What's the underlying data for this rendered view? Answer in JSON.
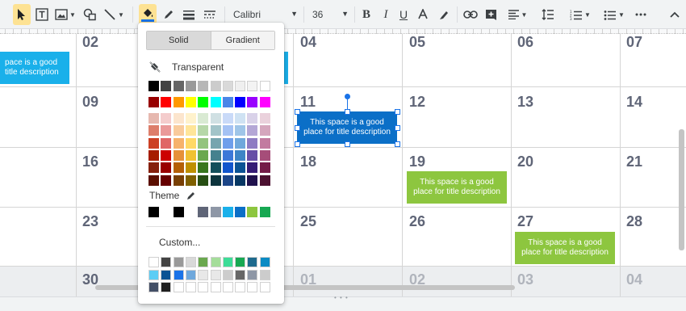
{
  "toolbar": {
    "font_name": "Calibri",
    "font_size": "36",
    "tools": [
      "select-tool",
      "text-tool",
      "image-tool",
      "shape-tool",
      "line-tool",
      "fill-color",
      "border-color",
      "border-weight",
      "border-dash"
    ],
    "fill_color_underline": "#1a73e8"
  },
  "calendar": {
    "rows": [
      [
        "02",
        "",
        "04",
        "05",
        "06",
        "07"
      ],
      [
        "09",
        "",
        "11",
        "12",
        "13",
        "14"
      ],
      [
        "16",
        "",
        "18",
        "19",
        "20",
        "21"
      ],
      [
        "23",
        "",
        "25",
        "26",
        "27",
        "28"
      ],
      [
        "30",
        "",
        "01",
        "02",
        "03",
        "04"
      ]
    ],
    "events": {
      "row1_blue_left": "pace is a good title description",
      "selected_11": "This space is a good place for title description",
      "green_19": "This space is a good place for title description",
      "green_27": "This space is a good place for title description"
    },
    "colors": {
      "blue": "#1ab0ea",
      "selected_blue": "#0b6fc7",
      "green": "#8dc63f",
      "day_text": "#5f6577"
    }
  },
  "color_picker": {
    "tab_solid": "Solid",
    "tab_gradient": "Gradient",
    "transparent_label": "Transparent",
    "theme_label": "Theme",
    "custom_label": "Custom...",
    "grays": [
      "#000000",
      "#434343",
      "#666666",
      "#999999",
      "#b7b7b7",
      "#cccccc",
      "#d9d9d9",
      "#efefef",
      "#f3f3f3",
      "#ffffff"
    ],
    "brights": [
      "#980000",
      "#ff0000",
      "#ff9900",
      "#ffff00",
      "#00ff00",
      "#00ffff",
      "#4a86e8",
      "#0000ff",
      "#9900ff",
      "#ff00ff"
    ],
    "shades": [
      [
        "#e6b8af",
        "#f4cccc",
        "#fce5cd",
        "#fff2cc",
        "#d9ead3",
        "#d0e0e3",
        "#c9daf8",
        "#cfe2f3",
        "#d9d2e9",
        "#ead1dc"
      ],
      [
        "#dd7e6b",
        "#ea9999",
        "#f9cb9c",
        "#ffe599",
        "#b6d7a8",
        "#a2c4c9",
        "#a4c2f4",
        "#9fc5e8",
        "#b4a7d6",
        "#d5a6bd"
      ],
      [
        "#cc4125",
        "#e06666",
        "#f6b26b",
        "#ffd966",
        "#93c47d",
        "#76a5af",
        "#6d9eeb",
        "#6fa8dc",
        "#8e7cc3",
        "#c27ba0"
      ],
      [
        "#a61c00",
        "#cc0000",
        "#e69138",
        "#f1c232",
        "#6aa84f",
        "#45818e",
        "#3c78d8",
        "#3d85c6",
        "#674ea7",
        "#a64d79"
      ],
      [
        "#85200c",
        "#990000",
        "#b45f06",
        "#bf9000",
        "#38761d",
        "#134f5c",
        "#1155cc",
        "#0b5394",
        "#351c75",
        "#741b47"
      ],
      [
        "#5b0f00",
        "#660000",
        "#783f04",
        "#7f6000",
        "#274e13",
        "#0c343d",
        "#1c4587",
        "#073763",
        "#20124d",
        "#4c1130"
      ]
    ],
    "theme": [
      "#000000",
      "#ffffff",
      "#000000",
      "#ffffff",
      "#5f6577",
      "#8e97a6",
      "#1ab0ea",
      "#0b6fc7",
      "#8dc63f",
      "#17a852"
    ],
    "custom": [
      [
        "#ffffff",
        "#434343",
        "#999999",
        "#d9d9d9",
        "#6aa84f",
        "#a4dd9a",
        "#3ddc97",
        "#17a852",
        "#1e6a8d",
        "#0b8bc4"
      ],
      [
        "#5bcdf5",
        "#0b5394",
        "#1a73e8",
        "#6fa8dc",
        "#e8e8e8",
        "#e8e8e8",
        "#cccccc",
        "#666666",
        "#8e97a6",
        "#cccccc"
      ],
      [
        "#434f66",
        "#1f1f1f",
        "#ffffff",
        "#ffffff",
        "#ffffff",
        "#ffffff",
        "#ffffff",
        "#ffffff",
        "#ffffff",
        "#ffffff"
      ]
    ]
  }
}
